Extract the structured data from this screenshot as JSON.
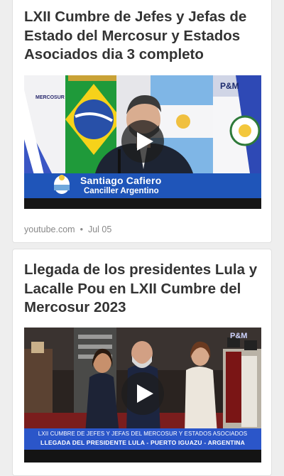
{
  "cards": [
    {
      "title": "LXII Cumbre de Jefes y Jefas de Estado del Mercosur y Estados Asociados dia 3 completo",
      "thumbnail": {
        "lower_third_name": "Santiago Cafiero",
        "lower_third_role": "Canciller Argentino",
        "logo": "MERCOSUR",
        "channel_logo": "P&M"
      },
      "source": "youtube.com",
      "separator": "•",
      "date": "Jul 05"
    },
    {
      "title": "Llegada de los presidentes Lula y Lacalle Pou en LXII Cumbre del Mercosur 2023",
      "thumbnail": {
        "chyron_line1": "LXII CUMBRE DE JEFES Y JEFAS DEL MERCOSUR Y ESTADOS ASOCIADOS",
        "chyron_line2": "LLEGADA DEL PRESIDENTE LULA - PUERTO IGUAZU - ARGENTINA",
        "channel_logo": "P&M"
      }
    }
  ],
  "icons": {
    "play": "play-icon"
  },
  "colors": {
    "title": "#333333",
    "meta": "#888888",
    "lower_third": "#1f55b9",
    "chyron": "#2b56c9"
  }
}
